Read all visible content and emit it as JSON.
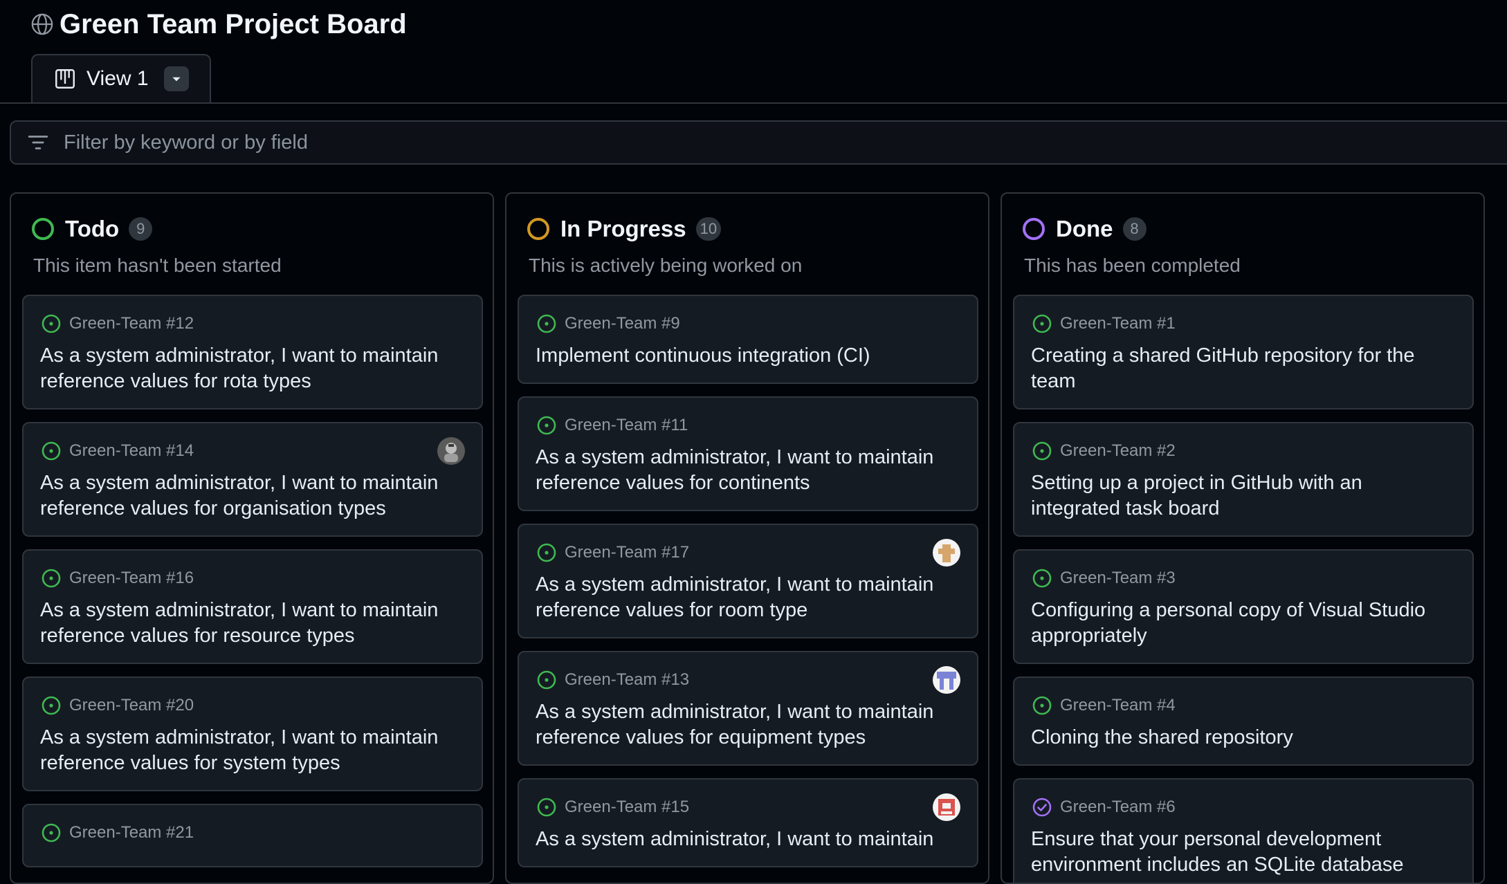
{
  "project": {
    "title": "Green Team Project Board"
  },
  "views": [
    {
      "label": "View 1"
    }
  ],
  "filter": {
    "placeholder": "Filter by keyword or by field",
    "value": ""
  },
  "colors": {
    "todo": "#3fb950",
    "in_progress": "#d29922",
    "done": "#a371f7",
    "background": "#010409",
    "card": "#151b23",
    "border": "#30363d"
  },
  "columns": [
    {
      "name": "Todo",
      "count": "9",
      "description": "This item hasn't been started",
      "cards": [
        {
          "ref": "Green-Team #12",
          "title": "As a system administrator, I want to maintain reference values for rota types",
          "state_icon": "issue-open-icon"
        },
        {
          "ref": "Green-Team #14",
          "title": "As a system administrator, I want to maintain reference values for organisation types",
          "state_icon": "issue-open-icon",
          "assignee_avatar": "avatar-1"
        },
        {
          "ref": "Green-Team #16",
          "title": "As a system administrator, I want to maintain reference values for resource types",
          "state_icon": "issue-open-icon"
        },
        {
          "ref": "Green-Team #20",
          "title": "As a system administrator, I want to maintain reference values for system types",
          "state_icon": "issue-open-icon"
        },
        {
          "ref": "Green-Team #21",
          "title": "",
          "state_icon": "issue-open-icon"
        }
      ]
    },
    {
      "name": "In Progress",
      "count": "10",
      "description": "This is actively being worked on",
      "cards": [
        {
          "ref": "Green-Team #9",
          "title": "Implement continuous integration (CI)",
          "state_icon": "issue-open-icon"
        },
        {
          "ref": "Green-Team #11",
          "title": "As a system administrator, I want to maintain reference values for continents",
          "state_icon": "issue-open-icon"
        },
        {
          "ref": "Green-Team #17",
          "title": "As a system administrator, I want to maintain reference values for room type",
          "state_icon": "issue-open-icon",
          "assignee_avatar": "avatar-2"
        },
        {
          "ref": "Green-Team #13",
          "title": "As a system administrator, I want to maintain reference values for equipment types",
          "state_icon": "issue-open-icon",
          "assignee_avatar": "avatar-3"
        },
        {
          "ref": "Green-Team #15",
          "title": "As a system administrator, I want to maintain",
          "state_icon": "issue-open-icon",
          "assignee_avatar": "avatar-4"
        }
      ]
    },
    {
      "name": "Done",
      "count": "8",
      "description": "This has been completed",
      "cards": [
        {
          "ref": "Green-Team #1",
          "title": "Creating a shared GitHub repository for the team",
          "state_icon": "issue-open-icon"
        },
        {
          "ref": "Green-Team #2",
          "title": "Setting up a project in GitHub with an integrated task board",
          "state_icon": "issue-open-icon"
        },
        {
          "ref": "Green-Team #3",
          "title": "Configuring a personal copy of Visual Studio appropriately",
          "state_icon": "issue-open-icon"
        },
        {
          "ref": "Green-Team #4",
          "title": "Cloning the shared repository",
          "state_icon": "issue-open-icon"
        },
        {
          "ref": "Green-Team #6",
          "title": "Ensure that your personal development environment includes an SQLite database",
          "state_icon": "issue-closed-icon"
        }
      ]
    }
  ]
}
